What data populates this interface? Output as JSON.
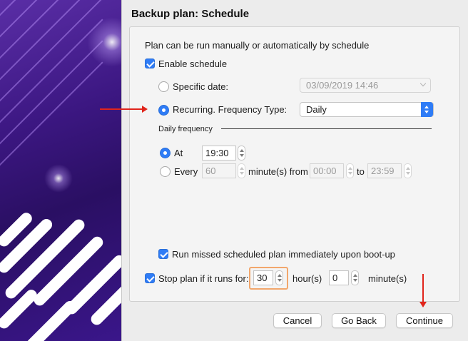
{
  "header": {
    "title": "Backup plan: Schedule"
  },
  "intro": "Plan can be run manually or automatically by schedule",
  "enable_schedule": {
    "label": "Enable schedule",
    "checked": true
  },
  "specific_date": {
    "label": "Specific date:",
    "selected": false,
    "value": "03/09/2019 14:46"
  },
  "recurring": {
    "label": "Recurring. Frequency Type:",
    "selected": true,
    "value": "Daily"
  },
  "daily_frequency": {
    "label": "Daily frequency",
    "at": {
      "label": "At",
      "selected": true,
      "value": "19:30"
    },
    "every": {
      "label": "Every",
      "selected": false,
      "value": "60",
      "unit_from": "minute(s) from",
      "from": "00:00",
      "to_label": "to",
      "to": "23:59"
    }
  },
  "run_missed": {
    "label": "Run missed scheduled plan immediately upon boot-up",
    "checked": true
  },
  "stop_plan": {
    "label": "Stop plan if it runs for:",
    "checked": true,
    "hours": "30",
    "hours_label": "hour(s)",
    "minutes": "0",
    "minutes_label": "minute(s)"
  },
  "buttons": {
    "cancel": "Cancel",
    "back": "Go Back",
    "continue": "Continue"
  },
  "colors": {
    "accent": "#2f7cf6",
    "annotation_arrow": "#e0241b",
    "highlight": "#f2a76c",
    "banner": "#3c1782"
  },
  "icons": [
    "checkbox-checked",
    "radio-selected",
    "radio-unselected",
    "stepper-arrows",
    "chevron-down-icon",
    "red-arrow-annotation"
  ]
}
